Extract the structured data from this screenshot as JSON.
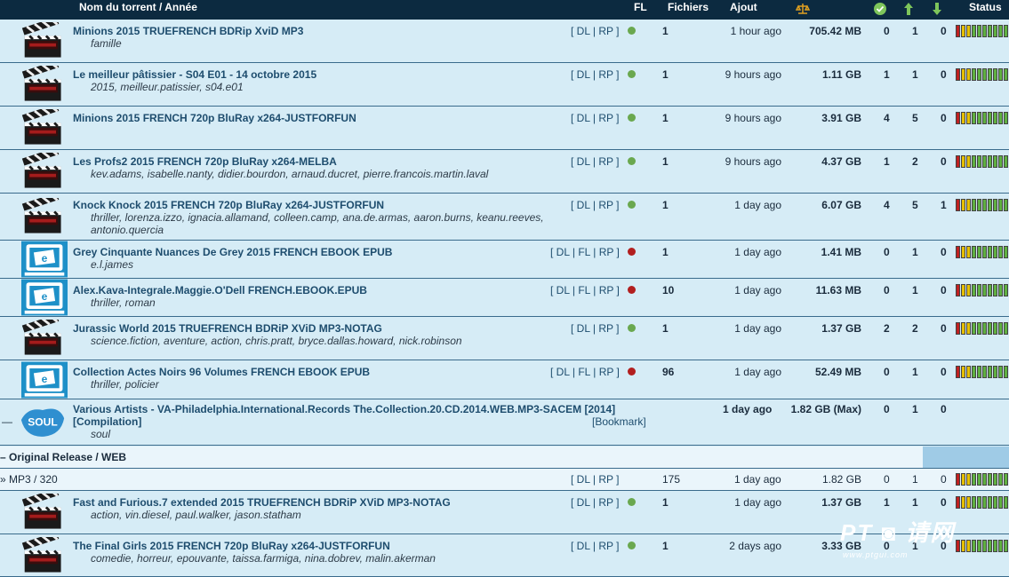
{
  "header": {
    "name": "Nom du torrent / Année",
    "fl": "FL",
    "files": "Fichiers",
    "added": "Ajout",
    "status": "Status",
    "icons": [
      "scales-icon",
      "check-circle-icon",
      "arrow-up-icon",
      "arrow-down-icon"
    ]
  },
  "rows": [
    {
      "title": "Minions 2015 TRUEFRENCH BDRip XviD MP3",
      "tags": "famille",
      "links": "[ DL | RP ]",
      "fl": "green",
      "files": "1",
      "added": "1 hour ago",
      "size": "705.42 MB",
      "check": "0",
      "up": "1",
      "down": "0",
      "icon": "clapperboard-icon"
    },
    {
      "title": "Le meilleur pâtissier - S04 E01 - 14 octobre 2015",
      "tags": "2015, meilleur.patissier, s04.e01",
      "links": "[ DL | RP ]",
      "fl": "green",
      "files": "1",
      "added": "9 hours ago",
      "size": "1.11 GB",
      "check": "1",
      "up": "1",
      "down": "0",
      "icon": "clapperboard-icon"
    },
    {
      "title": "Minions 2015 FRENCH 720p BluRay x264-JUSTFORFUN",
      "tags": "",
      "links": "[ DL | RP ]",
      "fl": "green",
      "files": "1",
      "added": "9 hours ago",
      "size": "3.91 GB",
      "check": "4",
      "up": "5",
      "down": "0",
      "icon": "clapperboard-icon"
    },
    {
      "title": "Les Profs2 2015 FRENCH 720p BluRay x264-MELBA",
      "tags": "kev.adams, isabelle.nanty, didier.bourdon, arnaud.ducret, pierre.francois.martin.laval",
      "links": "[ DL | RP ]",
      "fl": "green",
      "files": "1",
      "added": "9 hours ago",
      "size": "4.37 GB",
      "check": "1",
      "up": "2",
      "down": "0",
      "icon": "clapperboard-icon"
    },
    {
      "title": "Knock Knock 2015 FRENCH 720p BluRay x264-JUSTFORFUN",
      "tags": "thriller, lorenza.izzo, ignacia.allamand, colleen.camp, ana.de.armas, aaron.burns, keanu.reeves,",
      "tags2": "antonio.quercia",
      "links": "[ DL | RP ]",
      "fl": "green",
      "files": "1",
      "added": "1 day ago",
      "size": "6.07 GB",
      "check": "4",
      "up": "5",
      "down": "1",
      "icon": "clapperboard-icon"
    },
    {
      "title": "Grey Cinquante Nuances De Grey 2015 FRENCH EBOOK EPUB",
      "tags": "e.l.james",
      "links": "[ DL | FL | RP ]",
      "fl": "red",
      "files": "1",
      "added": "1 day ago",
      "size": "1.41 MB",
      "check": "0",
      "up": "1",
      "down": "0",
      "icon": "ebook-icon"
    },
    {
      "title": "Alex.Kava-Integrale.Maggie.O'Dell FRENCH.EBOOK.EPUB",
      "tags": "thriller, roman",
      "links": "[ DL | FL | RP ]",
      "fl": "red",
      "files": "10",
      "added": "1 day ago",
      "size": "11.63 MB",
      "check": "0",
      "up": "1",
      "down": "0",
      "icon": "ebook-icon"
    },
    {
      "title": "Jurassic World 2015 TRUEFRENCH BDRiP XViD MP3-NOTAG",
      "tags": "science.fiction, aventure, action, chris.pratt, bryce.dallas.howard, nick.robinson",
      "links": "[ DL | RP ]",
      "fl": "green",
      "files": "1",
      "added": "1 day ago",
      "size": "1.37 GB",
      "check": "2",
      "up": "2",
      "down": "0",
      "icon": "clapperboard-icon"
    },
    {
      "title": "Collection Actes Noirs 96 Volumes FRENCH EBOOK EPUB",
      "tags": "thriller, policier",
      "links": "[ DL | FL | RP ]",
      "fl": "red",
      "files": "96",
      "added": "1 day ago",
      "size": "52.49 MB",
      "check": "0",
      "up": "1",
      "down": "0",
      "icon": "ebook-icon"
    }
  ],
  "group": {
    "expander": "—",
    "title": "Various Artists - VA-Philadelphia.International.Records The.Collection.20.CD.2014.WEB.MP3-SACEM",
    "year": "[2014]",
    "subtitle": "[Compilation]",
    "tags": "soul",
    "bookmark": "[Bookmark]",
    "added": "1 day ago",
    "size": "1.82 GB (Max)",
    "check": "0",
    "up": "1",
    "down": "0",
    "icon_text": "SOUL"
  },
  "release": {
    "label": "– Original Release / WEB"
  },
  "format": {
    "label": "» MP3 / 320",
    "links": "[ DL | RP ]",
    "files": "175",
    "added": "1 day ago",
    "size": "1.82 GB",
    "check": "0",
    "up": "1",
    "down": "0"
  },
  "rows2": [
    {
      "title": "Fast and Furious.7 extended 2015 TRUEFRENCH BDRiP XViD MP3-NOTAG",
      "tags": "action, vin.diesel, paul.walker, jason.statham",
      "links": "[ DL | RP ]",
      "fl": "green",
      "files": "1",
      "added": "1 day ago",
      "size": "1.37 GB",
      "check": "1",
      "up": "1",
      "down": "0",
      "icon": "clapperboard-icon"
    },
    {
      "title": "The Final Girls 2015 FRENCH 720p BluRay x264-JUSTFORFUN",
      "tags": "comedie, horreur, epouvante, taissa.farmiga, nina.dobrev, malin.akerman",
      "links": "[ DL | RP ]",
      "fl": "green",
      "files": "1",
      "added": "2 days ago",
      "size": "3.33 GB",
      "check": "0",
      "up": "1",
      "down": "0",
      "icon": "clapperboard-icon"
    }
  ],
  "colors": {
    "header_bg": "#0c2a40",
    "row_bg": "#d6ecf6",
    "link": "#1e4d6e",
    "fl_green": "#6aa84f",
    "fl_red": "#b21f1f"
  }
}
